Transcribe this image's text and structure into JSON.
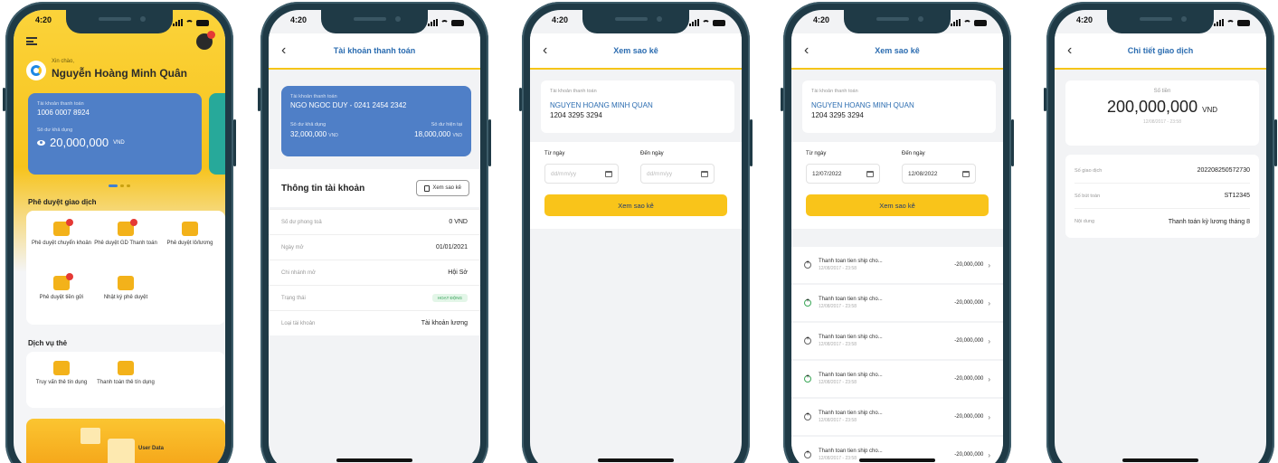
{
  "status_time": "4:20",
  "screen1": {
    "hello": "Xin chào,",
    "name": "Nguyễn Hoàng Minh Quân",
    "card": {
      "account_label": "Tài khoản thanh toán",
      "account_no": "1006 0007 8924",
      "balance_label": "Số dư khả dụng",
      "balance": "20,000,000",
      "currency": "VND"
    },
    "approvals_title": "Phê duyệt giao dịch",
    "approvals": [
      "Phê duyệt chuyển khoản",
      "Phê duyệt GD Thanh toán",
      "Phê duyệt lô/lương",
      "Phê duyệt tiền gửi",
      "Nhật ký phê duyệt"
    ],
    "card_services_title": "Dịch vụ thẻ",
    "card_services": [
      "Truy vấn thẻ tín dụng",
      "Thanh toán thẻ tín dụng"
    ],
    "promo_text": "User Data"
  },
  "screen2": {
    "title": "Tài khoản thanh toán",
    "card": {
      "label": "Tài khoản thanh toán",
      "name": "NGO NGOC DUY - 0241 2454 2342",
      "left_label": "Số dư khả dụng",
      "right_label": "Số dư hiện tại",
      "left_value": "32,000,000",
      "right_value": "18,000,000",
      "currency": "VND"
    },
    "info_title": "Thông tin tài khoản",
    "statement_button": "Xem sao kê",
    "rows": [
      {
        "k": "Số dư phong toả",
        "v": "0 VND"
      },
      {
        "k": "Ngày mở",
        "v": "01/01/2021"
      },
      {
        "k": "Chi nhánh mở",
        "v": "Hội Sở"
      },
      {
        "k": "Trạng thái",
        "v": "HOẠT ĐỘNG"
      },
      {
        "k": "Loại tài khoản",
        "v": "Tài khoản lương"
      }
    ]
  },
  "statement": {
    "title": "Xem sao kê",
    "account_label": "Tài khoản thanh toán",
    "account_name": "NGUYEN HOANG MINH QUAN",
    "account_no": "1204 3295 3294",
    "from_label": "Từ ngày",
    "to_label": "Đến ngày",
    "placeholder": "dd/mm/yy",
    "from_value": "12/07/2022",
    "to_value": "12/08/2022",
    "button": "Xem sao kê",
    "transactions": [
      {
        "desc": "Thanh toan tien ship cho...",
        "date": "12/08/2017 - 23:58",
        "amount": "-20,000,000"
      },
      {
        "desc": "Thanh toan tien ship cho...",
        "date": "12/08/2017 - 23:58",
        "amount": "-20,000,000"
      },
      {
        "desc": "Thanh toan tien ship cho...",
        "date": "12/08/2017 - 23:58",
        "amount": "-20,000,000"
      },
      {
        "desc": "Thanh toan tien ship cho...",
        "date": "12/08/2017 - 23:58",
        "amount": "-20,000,000"
      },
      {
        "desc": "Thanh toan tien ship cho...",
        "date": "12/08/2017 - 23:58",
        "amount": "-20,000,000"
      },
      {
        "desc": "Thanh toan tien ship cho...",
        "date": "12/08/2017 - 23:58",
        "amount": "-20,000,000"
      }
    ]
  },
  "screen5": {
    "title": "Chi tiết giao dịch",
    "amount_label": "Số tiền",
    "amount": "200,000,000",
    "currency": "VND",
    "datetime": "12/08/2017 - 23:58",
    "rows": [
      {
        "k": "Số giao dịch",
        "v": "202208250572730"
      },
      {
        "k": "Số bút toán",
        "v": "ST12345"
      },
      {
        "k": "Nội dung",
        "v": "Thanh toán kỳ lương tháng 8"
      }
    ]
  },
  "colors": {
    "frame": "#1f3a46",
    "yellow": "#f9c41a",
    "card_blue": "#4f7fc7",
    "link_blue": "#2b6cb0"
  }
}
